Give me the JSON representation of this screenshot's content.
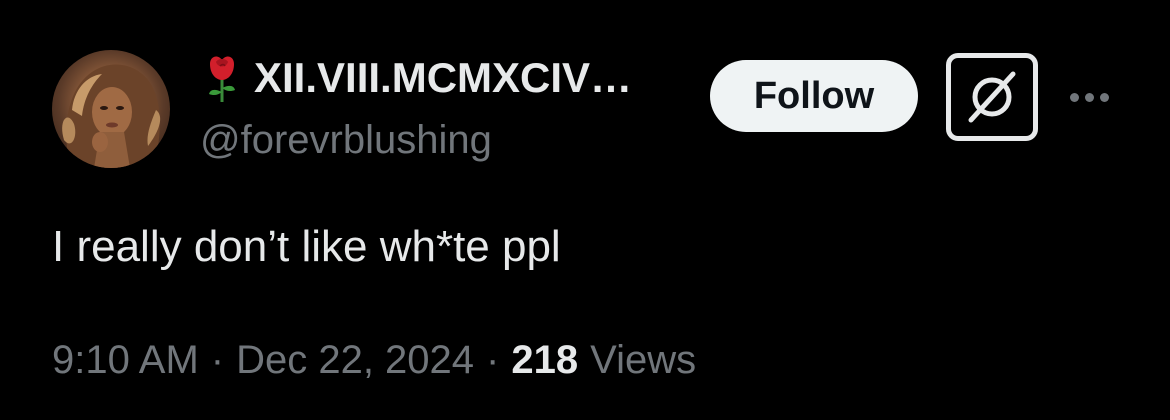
{
  "tweet": {
    "author": {
      "display_name": "XII.VIII.MCMXCIV…",
      "handle": "@forevrblushing",
      "name_emoji": "rose-icon",
      "avatar": "avatar-photo"
    },
    "follow_label": "Follow",
    "grok_icon": "grok-icon",
    "more_icon": "more-icon",
    "text": "I really don’t like wh*te ppl",
    "meta": {
      "time": "9:10 AM",
      "separator": "·",
      "date": "Dec 22, 2024",
      "views_count": "218",
      "views_label": "Views"
    }
  },
  "colors": {
    "background": "#000000",
    "primary_text": "#e7e9ea",
    "secondary_text": "#71767b",
    "follow_bg": "#eff3f4",
    "follow_text": "#0f1419",
    "rose": "#d21f2b"
  }
}
